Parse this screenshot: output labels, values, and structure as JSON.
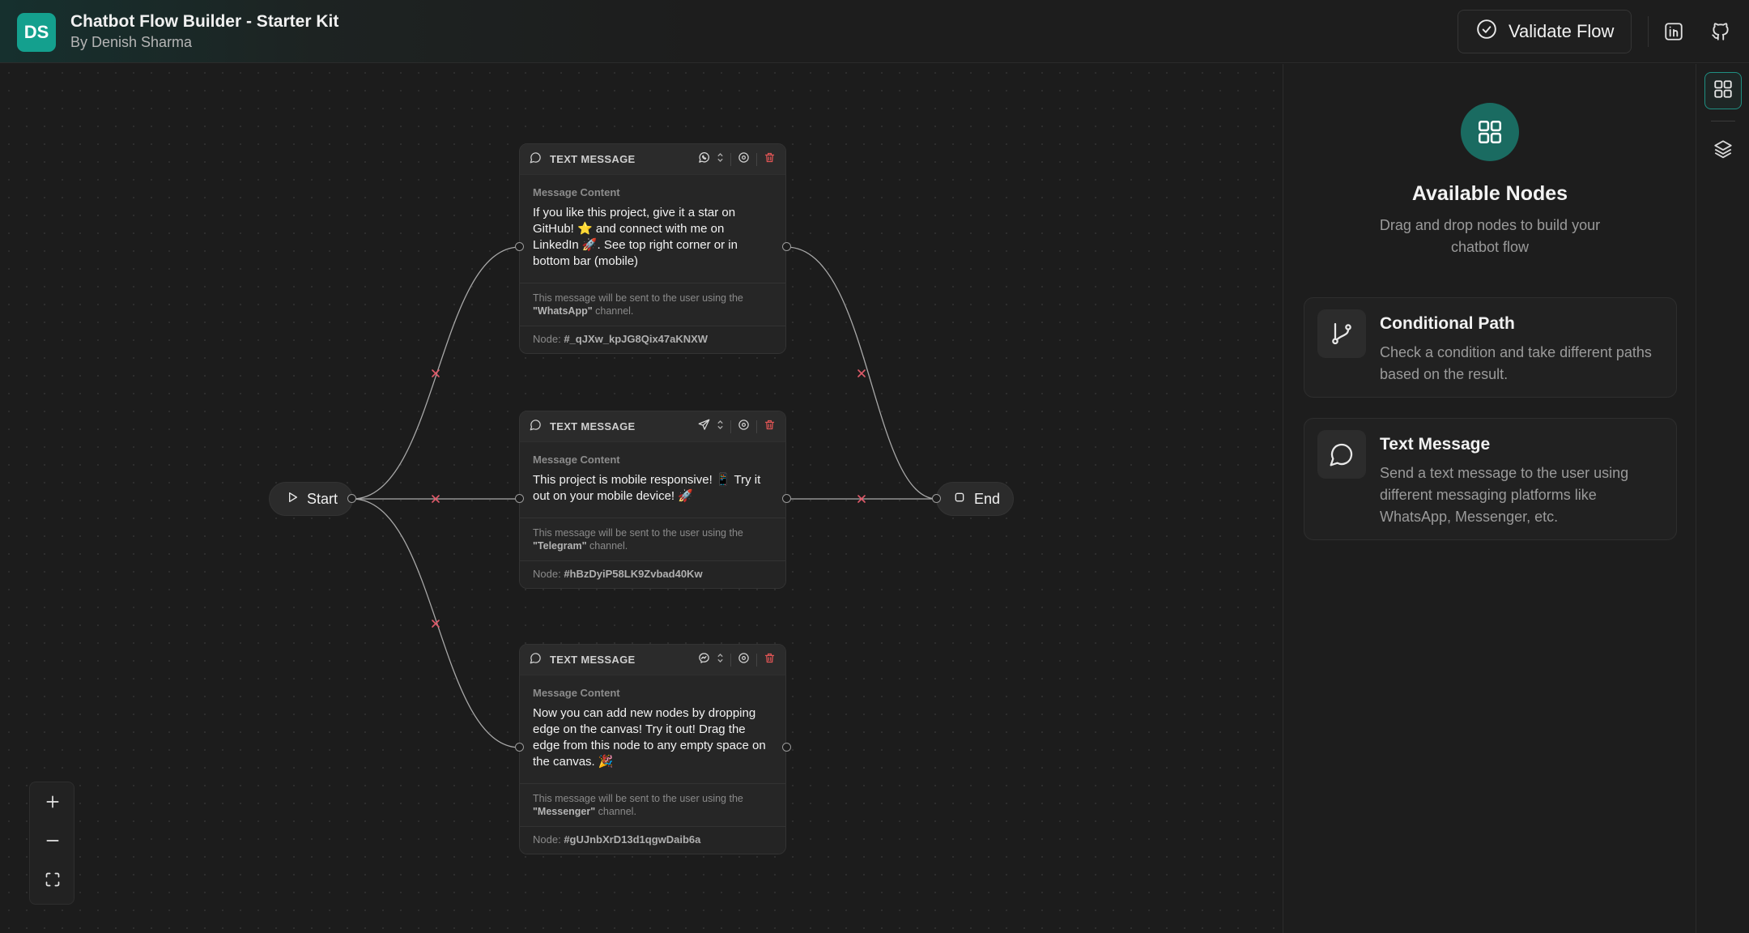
{
  "header": {
    "logo_text": "DS",
    "title": "Chatbot Flow Builder - Starter Kit",
    "subtitle": "By Denish Sharma",
    "validate_label": "Validate Flow",
    "icons": [
      "check-circle-icon",
      "linkedin-icon",
      "github-icon"
    ]
  },
  "canvas": {
    "start_label": "Start",
    "end_label": "End",
    "nodes": [
      {
        "type": "TEXT MESSAGE",
        "field_label": "Message Content",
        "message": "If you like this project, give it a star on GitHub! ⭐ and connect with me on LinkedIn 🚀. See top right corner or in bottom bar (mobile)",
        "note_prefix": "This message will be sent to the user using the",
        "channel": "\"WhatsApp\"",
        "note_suffix": "channel.",
        "node_prefix": "Node:",
        "node_id": "#_qJXw_kpJG8Qix47aKNXW",
        "channel_icon": "whatsapp-icon"
      },
      {
        "type": "TEXT MESSAGE",
        "field_label": "Message Content",
        "message": "This project is mobile responsive! 📱 Try it out on your mobile device! 🚀",
        "note_prefix": "This message will be sent to the user using the",
        "channel": "\"Telegram\"",
        "note_suffix": "channel.",
        "node_prefix": "Node:",
        "node_id": "#hBzDyiP58LK9Zvbad40Kw",
        "channel_icon": "telegram-icon"
      },
      {
        "type": "TEXT MESSAGE",
        "field_label": "Message Content",
        "message": "Now you can add new nodes by dropping edge on the canvas! Try it out! Drag the edge from this node to any empty space on the canvas. 🎉",
        "note_prefix": "This message will be sent to the user using the",
        "channel": "\"Messenger\"",
        "note_suffix": "channel.",
        "node_prefix": "Node:",
        "node_id": "#gUJnbXrD13d1qgwDaib6a",
        "channel_icon": "messenger-icon"
      }
    ],
    "zoom_controls": [
      "zoom-in-icon",
      "zoom-out-icon",
      "fit-view-icon"
    ]
  },
  "panel": {
    "title": "Available Nodes",
    "description": "Drag and drop nodes to build your chatbot flow",
    "cards": [
      {
        "title": "Conditional Path",
        "description": "Check a condition and take different paths based on the result.",
        "icon": "git-branch-icon"
      },
      {
        "title": "Text Message",
        "description": "Send a text message to the user using different messaging platforms like WhatsApp, Messenger, etc.",
        "icon": "message-circle-icon"
      }
    ]
  },
  "rail": {
    "icons": [
      "grid-icon",
      "layers-icon"
    ]
  },
  "colors": {
    "accent": "#14a08e",
    "accent_dark": "#1a6b61",
    "delete": "#e05555",
    "edge_marker": "#e05a6a"
  }
}
